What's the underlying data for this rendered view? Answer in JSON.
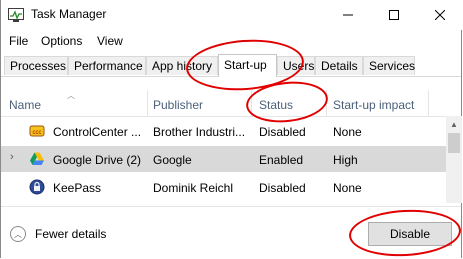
{
  "window": {
    "title": "Task Manager"
  },
  "menu": {
    "items": [
      "File",
      "Options",
      "View"
    ]
  },
  "tabs": [
    "Processes",
    "Performance",
    "App history",
    "Start-up",
    "Users",
    "Details",
    "Services"
  ],
  "active_tab": "Start-up",
  "table": {
    "columns": [
      "Name",
      "Publisher",
      "Status",
      "Start-up impact"
    ],
    "rows": [
      {
        "name": "ControlCenter ...",
        "publisher": "Brother Industri...",
        "status": "Disabled",
        "impact": "None",
        "icon": "brother-cc-icon",
        "selected": false
      },
      {
        "name": "Google Drive (2)",
        "publisher": "Google",
        "status": "Enabled",
        "impact": "High",
        "icon": "google-drive-icon",
        "selected": true
      },
      {
        "name": "KeePass",
        "publisher": "Dominik Reichl",
        "status": "Disabled",
        "impact": "None",
        "icon": "keepass-lock-icon",
        "selected": false
      }
    ]
  },
  "footer": {
    "fewer_details": "Fewer details",
    "action_button": "Disable"
  },
  "annotations": {
    "color": "#e00000"
  }
}
